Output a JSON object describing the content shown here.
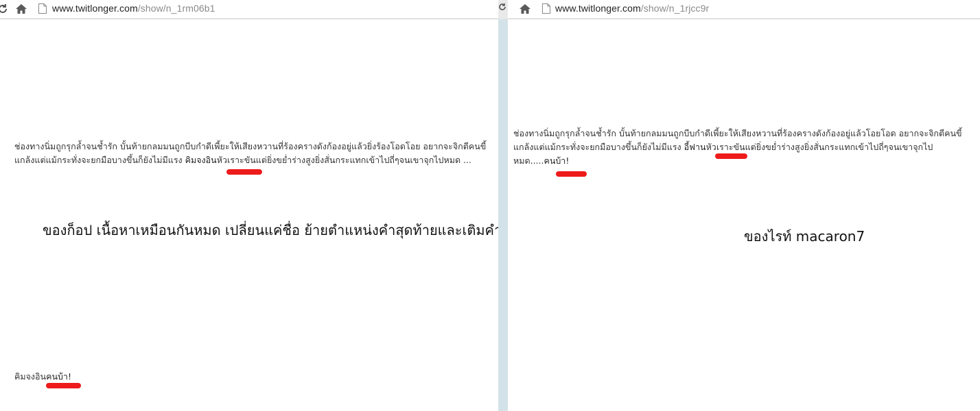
{
  "left_pane": {
    "url_domain": "www.twitlonger.com",
    "url_path": "/show/n_1rm06b1",
    "paragraph_before": "ช่องทางนิ่มถูกรุกล้ำจนช้ำรัก บั้นท้ายกลมมนถูกบีบกำดีเพี้ยะให้เสียงหวานที่ร้องครางดังก้องอยู่แล้วยิ่งร้องโอดโอย อยากจะจิกตีคนขี้แกล้งแต่แม้กระทั่งจะยกมือบางขึ้นก็ยังไม่มีแรง ",
    "paragraph_highlight": "คิมจงอิน",
    "paragraph_after": "หัวเราะขันแต่ยิ่งขย่ำร่างสูงยิ่งสั่นกระแทกเข้าไปถี่ๆจนเขาจุกไปหมด ...",
    "caption": "ของก็อป   เนื้อหาเหมือนกันหมด เปลี่ยนแค่ชื่อ ย้ายตำแหน่งคำสุดท้ายและเติมคำ",
    "footer_prefix": "คิมจงอิน",
    "footer_highlight": "คนบ้า!"
  },
  "right_pane": {
    "url_domain": "www.twitlonger.com",
    "url_path": "/show/n_1rjcc9r",
    "paragraph_before": "ช่องทางนิ่มถูกรุกล้ำจนช้ำรัก บั้นท้ายกลมมนถูกบีบกำดีเพี้ยะให้เสียงหวานที่ร้องครางดังก้องอยู่แล้วโอยโอด อยากจะจิกตีคนขี้แกล้งแต่แม้กระทั่งจะยกมือบางขึ้นก็ยังไม่มีแรง ",
    "paragraph_highlight": "อี้ฟาน",
    "paragraph_after": "หัวเราะขันแต่ยิ่งขย่ำร่างสูงยิ่งสั่นกระแทกเข้าไปถี่ๆจนเขาจุกไปหมด.....",
    "paragraph_end_highlight": "คนบ้า!",
    "caption": "ของไรท์ macaron7"
  },
  "colors": {
    "annotation": "#ee1b1b",
    "divider": "#d3e2e8"
  },
  "icons": {
    "reload": "reload-icon",
    "home": "home-icon",
    "page": "page-icon"
  }
}
